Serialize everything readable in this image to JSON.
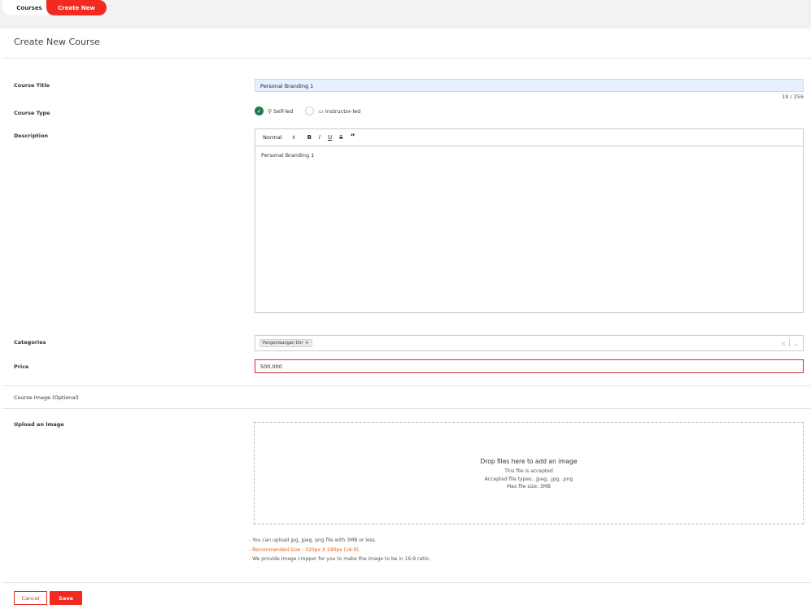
{
  "breadcrumb": {
    "items": [
      "Courses",
      "Create New"
    ]
  },
  "page": {
    "title": "Create New Course"
  },
  "form": {
    "course_title": {
      "label": "Course Title",
      "value": "Personal Branding 1",
      "counter": "19 / 256"
    },
    "course_type": {
      "label": "Course Type",
      "options": [
        "Self-led",
        "Instructor-led"
      ],
      "selected": "Self-led"
    },
    "description": {
      "label": "Description",
      "format_select": "Normal",
      "toolbar": [
        "B",
        "I",
        "U",
        "S",
        "”"
      ],
      "content": "Personal Branding 1"
    },
    "categories": {
      "label": "Categories",
      "tags": [
        "Pengembangan Diri"
      ]
    },
    "price": {
      "label": "Price",
      "value": "500,000"
    },
    "image_section": {
      "label": "Course Image (Optional)"
    },
    "upload": {
      "label": "Upload an Image",
      "dropzone_title": "Drop files here to add an image",
      "lines": [
        "This file is accepted",
        "Accepted file types: .jpeg, .jpg, .png",
        "Max file size: 3MB"
      ],
      "notes": [
        "- You can upload jpg, jpeg, png file with 3MB or less.",
        "- Recommended Size : 320px X 180px (16:9).",
        "- We provide image cropper for you to make the image to be in 16:9 ratio."
      ]
    }
  },
  "actions": {
    "cancel": "Cancel",
    "save": "Save"
  },
  "colors": {
    "accent": "#f22a1f",
    "success": "#1b7f4b",
    "warning": "#e85c0a"
  },
  "icons": [
    "check-icon",
    "person-icon",
    "chat-icon",
    "remove-tag-icon",
    "clear-icon",
    "chevron-down-icon",
    "dropdown-caret-icon"
  ]
}
